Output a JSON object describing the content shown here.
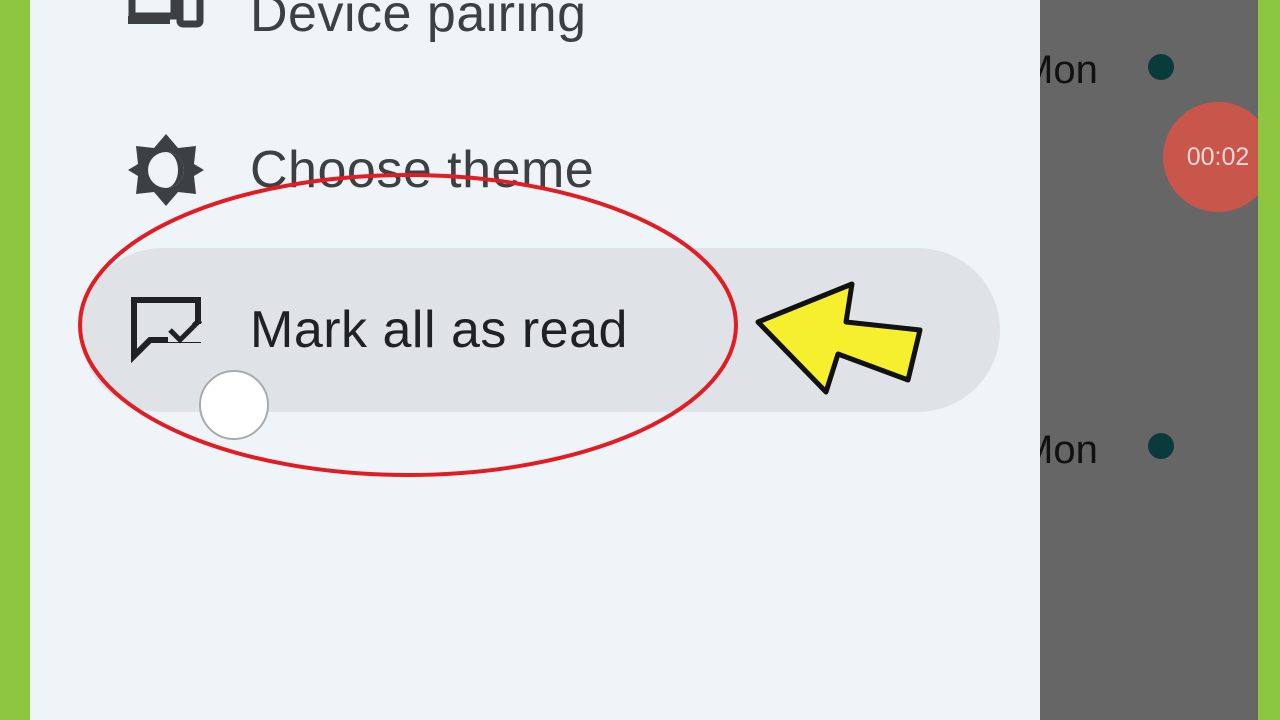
{
  "menu": {
    "items": [
      {
        "label": "Device pairing",
        "icon": "device-pairing-icon"
      },
      {
        "label": "Choose theme",
        "icon": "theme-brightness-icon"
      },
      {
        "label": "Mark all as read",
        "icon": "chat-check-icon",
        "highlighted": true
      }
    ]
  },
  "list": {
    "rows": [
      {
        "day": "Mon"
      },
      {
        "day": "Mon"
      }
    ]
  },
  "timer": {
    "value": "00:02"
  },
  "colors": {
    "frame": "#8dc63f",
    "drawer_background": "#eff4f8",
    "highlight_pill": "#dfe3e7",
    "scrim": "#666666",
    "annotation_circle": "#e31b23",
    "annotation_arrow": "#f5ef2d",
    "timer_bubble": "#c9564a",
    "unread_dot": "#0b3a3a"
  }
}
